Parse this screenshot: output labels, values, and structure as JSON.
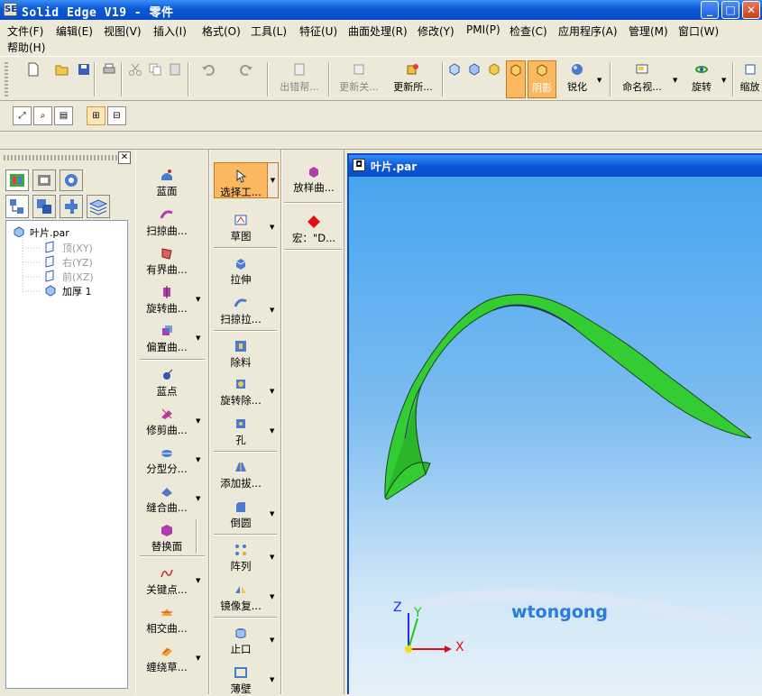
{
  "app": {
    "title": "Solid Edge V19 - 零件",
    "icon_label": "SE"
  },
  "window_controls": {
    "minimize": "_",
    "maximize": "□",
    "close": "✕"
  },
  "menu": [
    "文件(F)",
    "编辑(E)",
    "视图(V)",
    "插入(I)",
    "格式(O)",
    "工具(L)",
    "特征(U)",
    "曲面处理(R)",
    "修改(Y)",
    "PMI(P)",
    "检查(C)",
    "应用程序(A)",
    "管理(M)",
    "窗口(W)",
    "帮助(H)"
  ],
  "toolbar": {
    "error_help": "出错帮...",
    "update_related": "更新关...",
    "update_all": "更新所...",
    "shading": "阴影",
    "sharpen": "锐化",
    "named_view": "命名视...",
    "rotate": "旋转",
    "zoom": "缩放"
  },
  "tree": {
    "root": "叶片.par",
    "planes": [
      "顶(XY)",
      "右(YZ)",
      "前(XZ)"
    ],
    "feature": "加厚 1"
  },
  "surface_col": [
    "蓝面",
    "扫掠曲...",
    "有界曲...",
    "旋转曲...",
    "偏置曲...",
    "蓝点",
    "修剪曲...",
    "分型分...",
    "缝合曲...",
    "替换面",
    "关键点...",
    "相交曲...",
    "缠绕草..."
  ],
  "feature_col": [
    "选择工...",
    "草图",
    "拉伸",
    "扫掠拉...",
    "除料",
    "旋转除...",
    "孔",
    "添加拔...",
    "倒圆",
    "阵列",
    "镜像复...",
    "止口",
    "薄壁"
  ],
  "extra_col": {
    "loft": "放样曲...",
    "macro": "宏：\"D..."
  },
  "graphics": {
    "window_title": "叶片.par",
    "watermark": "wtongong",
    "axes": {
      "x": "X",
      "y": "Y",
      "z": "Z"
    }
  },
  "colors": {
    "accent": "#0a4cc6",
    "blade": "#22bb22",
    "highlight": "#fcb860"
  }
}
